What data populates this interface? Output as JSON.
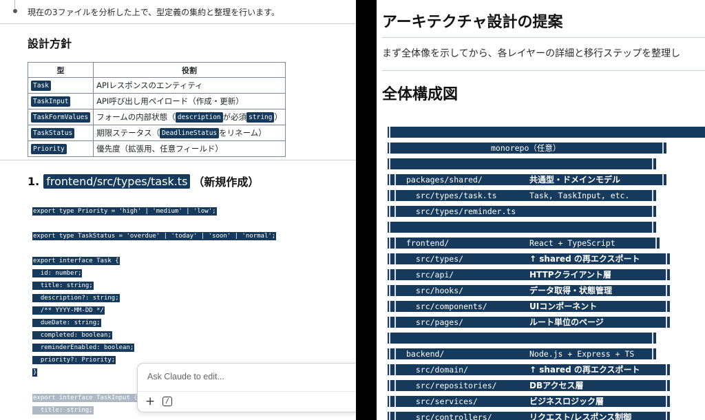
{
  "left": {
    "intro": "現在の3ファイルを分析した上で、型定義の集約と整理を行います。",
    "design_heading": "設計方針",
    "table": {
      "headers": [
        "型",
        "役割"
      ],
      "rows": [
        {
          "type": "Task",
          "role_parts": [
            "APIレスポンスのエンティティ"
          ]
        },
        {
          "type": "TaskInput",
          "role_parts": [
            "API呼び出し用ペイロード（作成・更新）"
          ]
        },
        {
          "type": "TaskFormValues",
          "role_parts": [
            "フォームの内部状態（",
            "description",
            "が必須",
            "string",
            "）"
          ]
        },
        {
          "type": "TaskStatus",
          "role_parts": [
            "期限ステータス（",
            "DeadlineStatus",
            "をリネーム）"
          ]
        },
        {
          "type": "Priority",
          "role_parts": [
            "優先度（拡張用、任意フィールド）"
          ]
        }
      ]
    },
    "file_heading": {
      "number": "1.",
      "path": "frontend/src/types/task.ts",
      "suffix": "（新規作成）"
    },
    "code_lines": [
      "export type Priority = 'high' | 'medium' | 'low';",
      "export type TaskStatus = 'overdue' | 'today' | 'soon' | 'normal';",
      "export interface Task {",
      "  id: number;",
      "  title: string;",
      "  description?: string;",
      "  /** YYYY-MM-DD */",
      "  dueDate: string;",
      "  completed: boolean;",
      "  reminderEnabled: boolean;",
      "  priority?: Priority;",
      "}",
      "export interface TaskInput {",
      "  title: string;"
    ],
    "editor": {
      "placeholder": "Ask Claude to edit...",
      "plus": "+",
      "slash": "/"
    }
  },
  "right": {
    "title": "アーキテクチャ設計の提案",
    "lead": "まず全体像を示してから、各レイヤーの詳細と移行ステップを整理し",
    "section_heading": "全体構成図",
    "diagram": [
      {
        "path": "",
        "desc": ""
      },
      {
        "path": "monorepo（任意）",
        "desc": "",
        "center": true
      },
      {
        "path": "",
        "desc": ""
      },
      {
        "path": "packages/shared/",
        "desc": "共通型・ドメインモデル"
      },
      {
        "path": "  src/types/task.ts",
        "desc": "Task, TaskInput, etc.",
        "mono": true
      },
      {
        "path": "  src/types/reminder.ts",
        "desc": ""
      },
      {
        "path": "",
        "desc": ""
      },
      {
        "path": "frontend/",
        "desc": "React + TypeScript",
        "mono": true
      },
      {
        "path": "  src/types/",
        "desc": "↑ shared の再エクスポート"
      },
      {
        "path": "  src/api/",
        "desc": "HTTPクライアント層"
      },
      {
        "path": "  src/hooks/",
        "desc": "データ取得・状態管理"
      },
      {
        "path": "  src/components/",
        "desc": "UIコンポーネント"
      },
      {
        "path": "  src/pages/",
        "desc": "ルート単位のページ"
      },
      {
        "path": "",
        "desc": ""
      },
      {
        "path": "backend/",
        "desc": "Node.js + Express + TS",
        "mono": true
      },
      {
        "path": "  src/domain/",
        "desc": "↑ shared の再エクスポート"
      },
      {
        "path": "  src/repositories/",
        "desc": "DBアクセス層"
      },
      {
        "path": "  src/services/",
        "desc": "ビジネスロジック層"
      },
      {
        "path": "  src/controllers/",
        "desc": "リクエスト/レスポンス制御"
      }
    ]
  },
  "colors": {
    "code_bg": "#163a5c",
    "text": "#1f2328",
    "gap": "#000000"
  }
}
